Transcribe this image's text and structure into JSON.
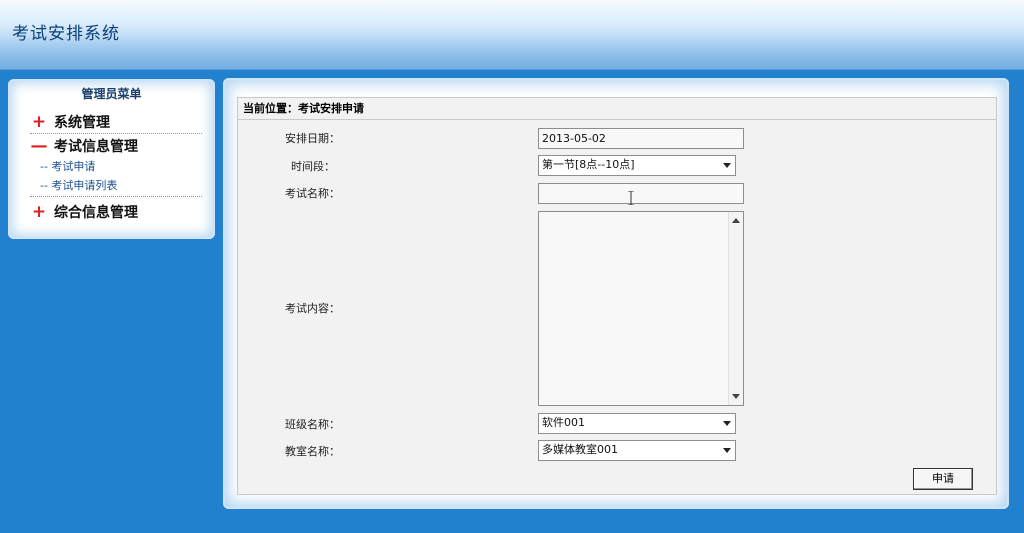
{
  "app": {
    "title": "考试安排系统"
  },
  "sidebar": {
    "title": "管理员菜单",
    "groups": [
      {
        "sign": "+",
        "label": "系统管理"
      },
      {
        "sign": "—",
        "label": "考试信息管理",
        "items": [
          "-- 考试申请",
          "-- 考试申请列表"
        ]
      },
      {
        "sign": "+",
        "label": "综合信息管理"
      }
    ]
  },
  "main": {
    "breadcrumb": "当前位置：考试安排申请",
    "form": {
      "date": {
        "label": "安排日期：",
        "value": "2013-05-02"
      },
      "period": {
        "label": "时间段：",
        "value": "第一节[8点--10点]"
      },
      "exam_name": {
        "label": "考试名称：",
        "value": ""
      },
      "exam_content": {
        "label": "考试内容：",
        "value": ""
      },
      "class_name": {
        "label": "班级名称：",
        "value": "软件001"
      },
      "room_name": {
        "label": "教室名称：",
        "value": "多媒体教室001"
      },
      "submit_label": "申请"
    }
  },
  "colors": {
    "background": "#2181cf",
    "menu_sign": "#e02020",
    "submenu_link": "#1a4f8f"
  }
}
